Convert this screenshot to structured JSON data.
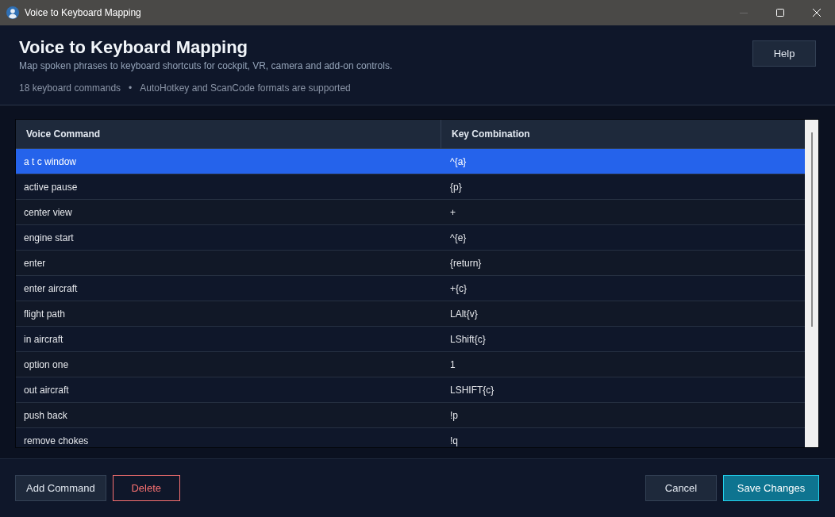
{
  "window": {
    "title": "Voice to Keyboard Mapping",
    "minimize_disabled": true
  },
  "header": {
    "title": "Voice to Keyboard Mapping",
    "subtitle": "Map spoken phrases to keyboard shortcuts for cockpit, VR, camera and add-on controls.",
    "stats": "18 keyboard commands",
    "separator": "•",
    "formats_note": "AutoHotkey and ScanCode formats are supported",
    "help_button": "Help"
  },
  "table": {
    "columns": [
      "Voice Command",
      "Key Combination"
    ],
    "rows": [
      {
        "voice_command": "a t c window",
        "key_combination": "^{a}",
        "selected": true
      },
      {
        "voice_command": "active pause",
        "key_combination": "{p}",
        "selected": false
      },
      {
        "voice_command": "center view",
        "key_combination": "+",
        "selected": false
      },
      {
        "voice_command": "engine start",
        "key_combination": "^{e}",
        "selected": false
      },
      {
        "voice_command": "enter",
        "key_combination": "{return}",
        "selected": false
      },
      {
        "voice_command": "enter aircraft",
        "key_combination": "+{c}",
        "selected": false
      },
      {
        "voice_command": "flight path",
        "key_combination": "LAlt{v}",
        "selected": false
      },
      {
        "voice_command": "in aircraft",
        "key_combination": "LShift{c}",
        "selected": false
      },
      {
        "voice_command": "option one",
        "key_combination": "1",
        "selected": false
      },
      {
        "voice_command": "out aircraft",
        "key_combination": "LSHIFT{c}",
        "selected": false
      },
      {
        "voice_command": "push back",
        "key_combination": "!p",
        "selected": false
      },
      {
        "voice_command": "remove chokes",
        "key_combination": "!q",
        "selected": false
      }
    ]
  },
  "footer": {
    "left_buttons": [
      {
        "label": "Add Command",
        "kind": "secondary"
      },
      {
        "label": "Delete",
        "kind": "danger"
      }
    ],
    "right_buttons": [
      {
        "label": "Cancel",
        "kind": "secondary"
      },
      {
        "label": "Save Changes",
        "kind": "primary"
      }
    ]
  }
}
